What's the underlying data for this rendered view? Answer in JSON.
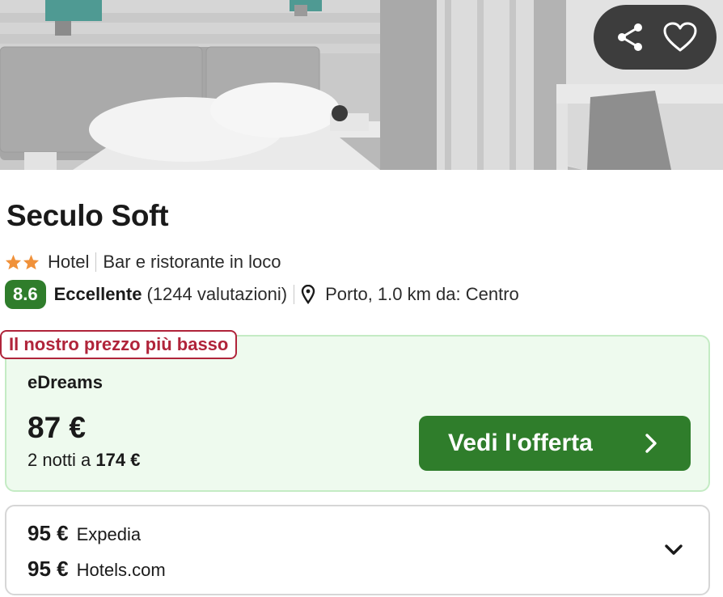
{
  "hotel": {
    "name": "Seculo Soft",
    "star_count": 2,
    "type": "Hotel",
    "amenity": "Bar e ristorante in loco",
    "rating_score": "8.6",
    "rating_label": "Eccellente",
    "rating_count": "(1244 valutazioni)",
    "location": "Porto, 1.0 km da: Centro"
  },
  "hero_actions": {
    "share_icon": "share-icon",
    "favorite_icon": "heart-icon"
  },
  "best_offer": {
    "badge": "Il nostro prezzo più basso",
    "provider": "eDreams",
    "price": "87 €",
    "total_prefix": "2 notti a",
    "total_amount": "174 €",
    "cta_label": "Vedi l'offerta"
  },
  "other_offers": [
    {
      "price": "95 €",
      "provider": "Expedia"
    },
    {
      "price": "95 €",
      "provider": "Hotels.com"
    }
  ],
  "colors": {
    "brand_green": "#2f7d2b",
    "badge_red": "#b0243a",
    "star_orange": "#f0913a",
    "offer_bg": "#eefaee"
  }
}
